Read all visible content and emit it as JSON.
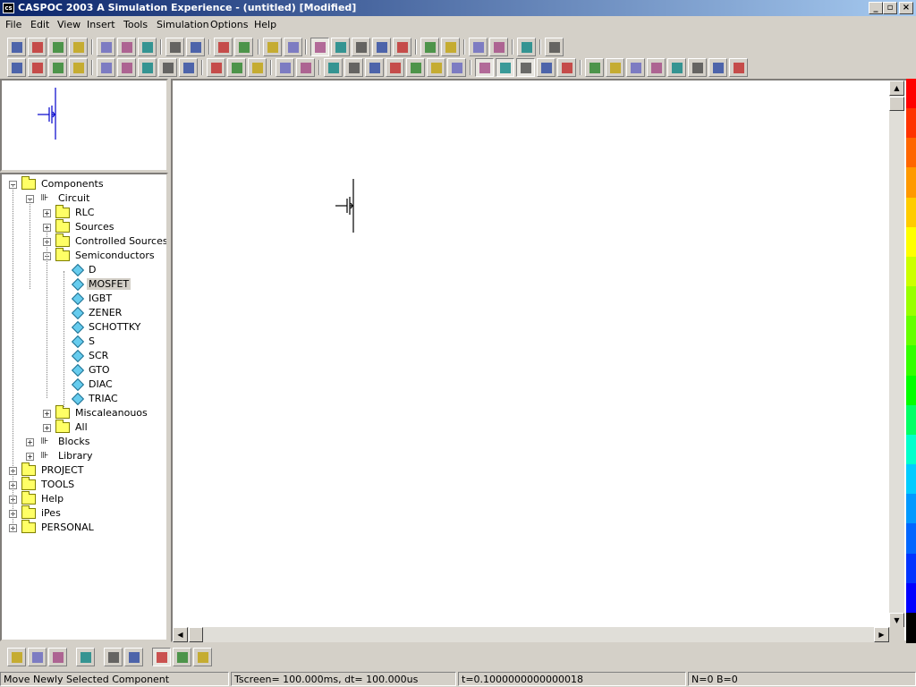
{
  "window": {
    "title": "CASPOC 2003 A Simulation Experience - (untitled) [Modified]",
    "app_icon": "cs"
  },
  "menu": [
    "File",
    "Edit",
    "View",
    "Insert",
    "Tools",
    "Simulation",
    "Options",
    "Help"
  ],
  "toolbar1": [
    "new-icon",
    "open-icon",
    "save-icon",
    "print-icon",
    "cut-icon",
    "copy-icon",
    "paste-icon",
    "undo-icon",
    "redo-icon",
    "run-icon",
    "pause-icon",
    "wire-icon",
    "line-icon",
    "hand-icon",
    "scope-icon",
    "list-icon",
    "list2-icon",
    "list3-icon",
    "connector-icon",
    "capacitor-icon",
    "component-icon",
    "component2-icon",
    "exchange-icon",
    "help-icon"
  ],
  "toolbar2": [
    "zoom-100-icon",
    "zoom-fit-icon",
    "zoom-width-icon",
    "zoom-height-icon",
    "node-icon",
    "resistor-icon",
    "pin-icon",
    "block-icon",
    "filter-icon",
    "globe-icon",
    "globe2-icon",
    "globe3-icon",
    "probe-icon",
    "text-icon",
    "palette-icon",
    "cross-icon",
    "arrow-icon",
    "arrow2-icon",
    "terminal-icon",
    "numbering-icon",
    "diagonal-icon",
    "crosshair-icon",
    "grid-icon",
    "clock-icon",
    "bucket-icon",
    "fill-icon",
    "move-icon",
    "flip-icon",
    "car-icon",
    "sort-icon",
    "chip-icon",
    "chip2-icon",
    "chip3-icon",
    "table-icon"
  ],
  "tree": {
    "root": "Components",
    "circuit": "Circuit",
    "groups": [
      "RLC",
      "Sources",
      "Controlled Sources",
      "Semiconductors"
    ],
    "semiconductors": [
      "D",
      "MOSFET",
      "IGBT",
      "ZENER",
      "SCHOTTKY",
      "S",
      "SCR",
      "GTO",
      "DIAC",
      "TRIAC"
    ],
    "selected": "MOSFET",
    "more_groups": [
      "Miscaleanouos",
      "All"
    ],
    "other": [
      "Blocks",
      "Library"
    ],
    "top_level": [
      "PROJECT",
      "TOOLS",
      "Help",
      "iPes",
      "PERSONAL"
    ]
  },
  "legend_colors": [
    "#ff0000",
    "#ff3300",
    "#ff6600",
    "#ff9900",
    "#ffcc00",
    "#ffff00",
    "#ccff00",
    "#99ff00",
    "#66ff00",
    "#33ff00",
    "#00ff00",
    "#00ff66",
    "#00ffcc",
    "#00ccff",
    "#0099ff",
    "#0066ff",
    "#0033ff",
    "#0000ff",
    "#000000"
  ],
  "bottom_toolbar": [
    "layout-icon",
    "tree-icon",
    "chip-icon",
    "refresh-icon",
    "window-icon",
    "windows-icon",
    "image-icon",
    "folder-icon",
    "edit-icon"
  ],
  "status": {
    "hint": "Move Newly Selected Component",
    "timing": "Tscreen= 100.000ms, dt= 100.000us",
    "time": "t=0.1000000000000018",
    "counts": "N=0 B=0"
  }
}
